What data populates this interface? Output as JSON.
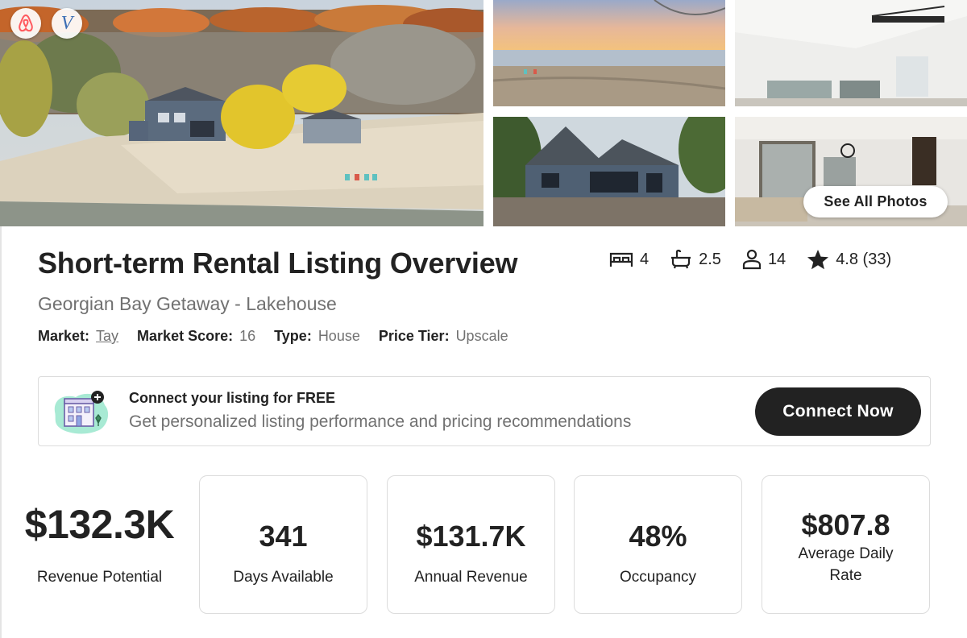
{
  "gallery": {
    "see_all_label": "See All Photos",
    "brands": [
      "airbnb-logo",
      "vrbo-logo"
    ],
    "vrbo_letter": "V"
  },
  "listing": {
    "title": "Short-term Rental Listing Overview",
    "name": "Georgian Bay Getaway - Lakehouse",
    "stats": {
      "bedrooms": "4",
      "bathrooms": "2.5",
      "guests": "14",
      "rating": "4.8 (33)"
    },
    "meta": {
      "market_label": "Market:",
      "market_value": "Tay",
      "score_label": "Market Score:",
      "score_value": "16",
      "type_label": "Type:",
      "type_value": "House",
      "tier_label": "Price Tier:",
      "tier_value": "Upscale"
    }
  },
  "connect": {
    "title": "Connect your listing for FREE",
    "description": "Get personalized listing performance and pricing recommendations",
    "button_label": "Connect Now"
  },
  "metrics": {
    "revenue_potential": {
      "value": "$132.3K",
      "label": "Revenue Potential"
    },
    "days_available": {
      "value": "341",
      "label": "Days Available"
    },
    "annual_revenue": {
      "value": "$131.7K",
      "label": "Annual Revenue"
    },
    "occupancy": {
      "value": "48%",
      "label": "Occupancy"
    },
    "adr": {
      "value": "$807.8",
      "label": "Average Daily Rate"
    }
  },
  "colors": {
    "text_primary": "#222222",
    "text_secondary": "#717171",
    "button_dark": "#222222",
    "airbnb_red": "#FF5A5F",
    "vrbo_blue": "#3D6FB5",
    "border": "#DCDCDC"
  }
}
